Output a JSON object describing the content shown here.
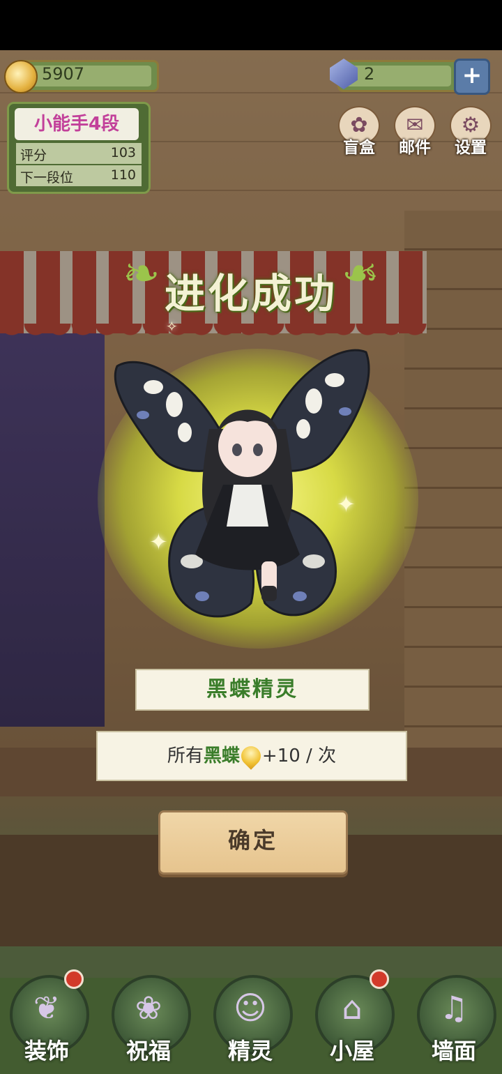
{
  "hud": {
    "coins": "5907",
    "gems": "2",
    "plus_symbol": "+"
  },
  "rank": {
    "title": "小能手4段",
    "score_label": "评分",
    "score_value": "103",
    "next_label": "下一段位",
    "next_value": "110"
  },
  "top_menu": [
    {
      "label": "盲盒",
      "icon": "gift-box-icon",
      "glyph": "✿"
    },
    {
      "label": "邮件",
      "icon": "mail-icon",
      "glyph": "✉"
    },
    {
      "label": "设置",
      "icon": "gear-icon",
      "glyph": "⚙"
    }
  ],
  "dialog": {
    "title": "进化成功",
    "fairy_name": "黑蝶精灵",
    "bonus_prefix": "所有",
    "bonus_item": "黑蝶",
    "bonus_suffix": "+10 / 次",
    "confirm_label": "确定"
  },
  "bottom_nav": [
    {
      "label": "装饰",
      "icon": "plant-decor-icon",
      "glyph": "❦",
      "badge": true
    },
    {
      "label": "祝福",
      "icon": "butterfly-blessing-icon",
      "glyph": "❀",
      "badge": false
    },
    {
      "label": "精灵",
      "icon": "fairy-icon",
      "glyph": "☺",
      "badge": false
    },
    {
      "label": "小屋",
      "icon": "house-icon",
      "glyph": "⌂",
      "badge": true
    },
    {
      "label": "墙面",
      "icon": "bell-wall-icon",
      "glyph": "♫",
      "badge": false
    }
  ],
  "colors": {
    "glow": "#e8f046",
    "name_green": "#3a7d2a",
    "badge_red": "#d23a2a"
  }
}
